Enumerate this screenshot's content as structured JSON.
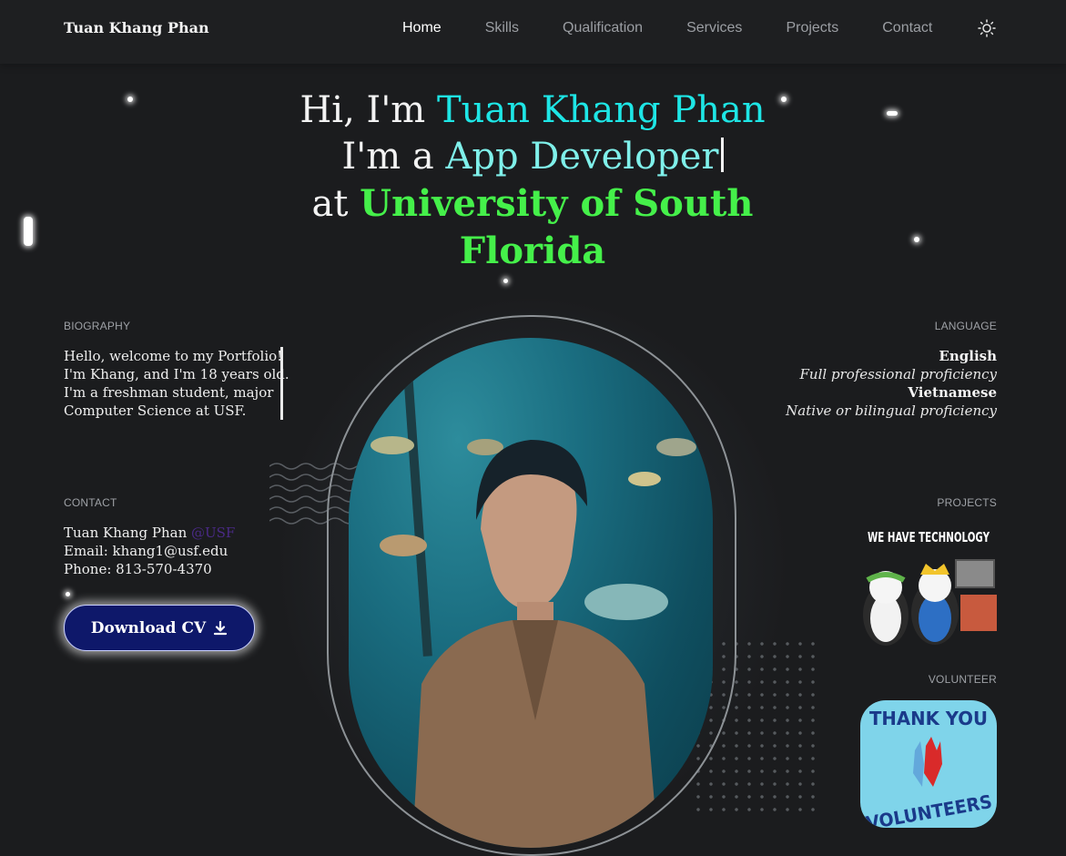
{
  "nav": {
    "brand": "Tuan Khang Phan",
    "links": [
      "Home",
      "Skills",
      "Qualification",
      "Services",
      "Projects",
      "Contact"
    ],
    "active": "Home",
    "theme_icon": "sun-icon"
  },
  "hero": {
    "greeting": "Hi, I'm ",
    "name": "Tuan Khang Phan",
    "role_prefix": "I'm a ",
    "role": "App Developer",
    "at_prefix": "at ",
    "school": "University of South Florida"
  },
  "biography": {
    "label": "BIOGRAPHY",
    "lines": [
      "Hello, welcome to my Portfolio!",
      "I'm Khang, and I'm 18 years old.",
      "I'm a freshman student, major",
      "Computer Science at USF."
    ]
  },
  "language": {
    "label": "LANGUAGE",
    "items": [
      {
        "name": "English",
        "level": "Full professional proficiency"
      },
      {
        "name": "Vietnamese",
        "level": "Native or bilingual proficiency"
      }
    ]
  },
  "contact": {
    "label": "CONTACT",
    "name": "Tuan Khang Phan ",
    "tag": "@USF",
    "email": "Email: khang1@usf.edu",
    "phone": "Phone: 813-570-4370",
    "cv_button": "Download CV",
    "cv_icon": "download-icon"
  },
  "projects": {
    "label": "PROJECTS",
    "image_text": "WE HAVE TECHNOLOGY"
  },
  "volunteer": {
    "label": "VOLUNTEER",
    "image_text_top": "THANK YOU",
    "image_text_bottom": "VOLUNTEERS"
  },
  "colors": {
    "background": "#1b1c1e",
    "name": "#1ee6e6",
    "role": "#7ff0ea",
    "school": "#45f04a",
    "button": "#0e186a"
  }
}
